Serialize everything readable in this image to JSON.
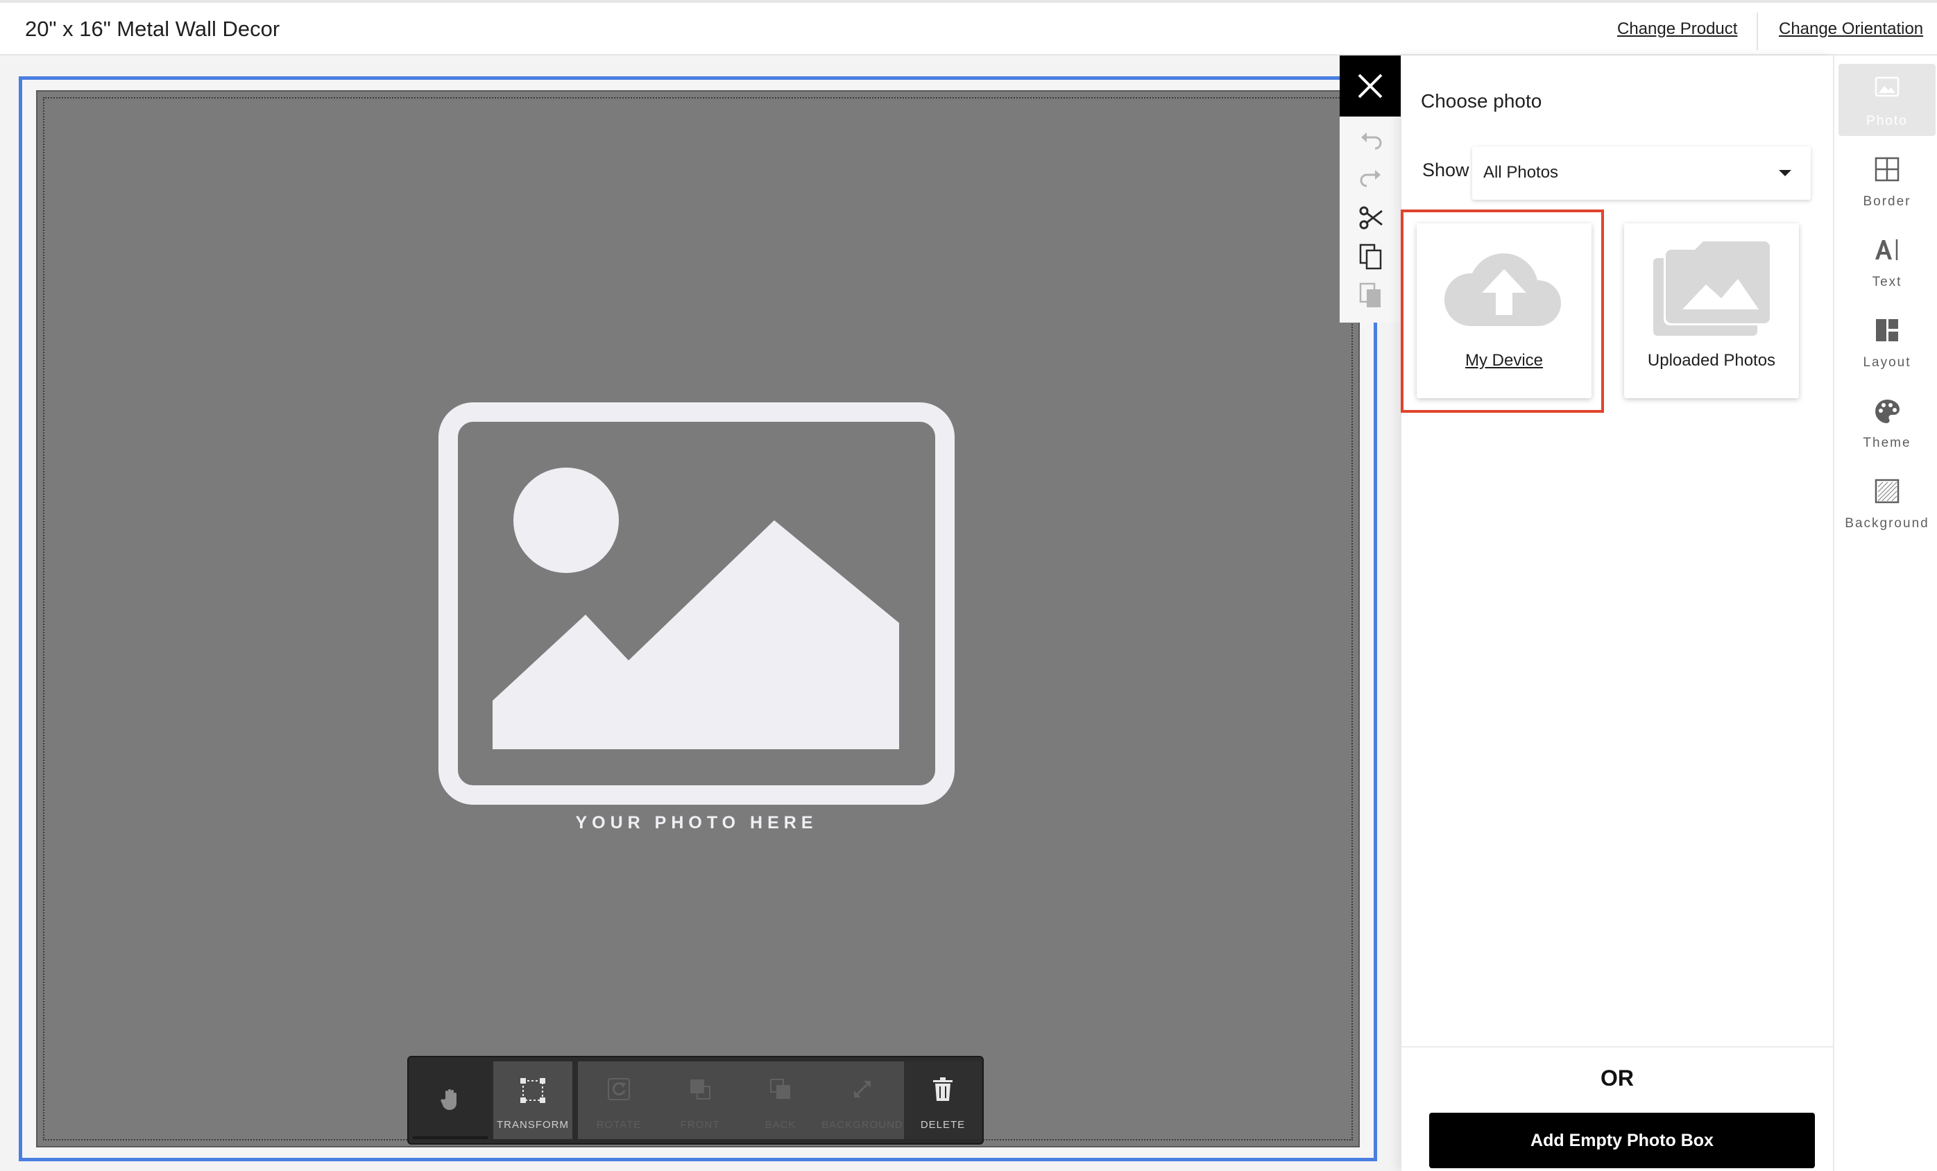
{
  "header": {
    "title": "20\" x 16\" Metal Wall Decor",
    "change_product": "Change Product",
    "change_orientation": "Change Orientation"
  },
  "canvas": {
    "placeholder_text": "YOUR PHOTO HERE"
  },
  "bottom_toolbar": {
    "items": [
      {
        "label": "",
        "icon": "hand-icon",
        "enabled": true
      },
      {
        "label": "TRANSFORM",
        "icon": "transform-icon",
        "enabled": true
      },
      {
        "label": "ROTATE",
        "icon": "rotate-icon",
        "enabled": false
      },
      {
        "label": "FRONT",
        "icon": "bring-front-icon",
        "enabled": false
      },
      {
        "label": "BACK",
        "icon": "send-back-icon",
        "enabled": false
      },
      {
        "label": "BACKGROUND",
        "icon": "expand-icon",
        "enabled": false
      },
      {
        "label": "DELETE",
        "icon": "trash-icon",
        "enabled": true
      }
    ]
  },
  "mini_tools": [
    "close-icon",
    "undo-icon",
    "redo-icon",
    "scissors-icon",
    "copy-icon",
    "paste-icon"
  ],
  "panel": {
    "title": "Choose photo",
    "show_label": "Show",
    "show_value": "All Photos",
    "sources": [
      {
        "label": "My Device",
        "icon": "cloud-upload-icon"
      },
      {
        "label": "Uploaded Photos",
        "icon": "photo-library-icon"
      }
    ],
    "or_text": "OR",
    "add_empty_label": "Add Empty Photo Box"
  },
  "rail": {
    "items": [
      {
        "label": "Photo",
        "icon": "photo-icon",
        "active": true
      },
      {
        "label": "Border",
        "icon": "border-icon",
        "active": false
      },
      {
        "label": "Text",
        "icon": "text-icon",
        "active": false
      },
      {
        "label": "Layout",
        "icon": "layout-icon",
        "active": false
      },
      {
        "label": "Theme",
        "icon": "palette-icon",
        "active": false
      },
      {
        "label": "Background",
        "icon": "background-icon",
        "active": false
      }
    ]
  },
  "colors": {
    "selection_border": "#4a7fe0",
    "highlight": "#e0442e",
    "photo_placeholder": "#7b7b7b"
  }
}
